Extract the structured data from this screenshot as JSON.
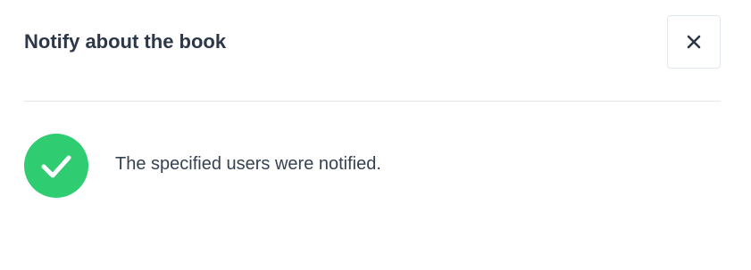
{
  "dialog": {
    "title": "Notify about the book",
    "close_icon": "close-icon",
    "message": "The specified users were notified.",
    "status_icon": "check-circle-icon"
  },
  "colors": {
    "success": "#2fcc71",
    "title_text": "#2d3748",
    "body_text": "#374151",
    "divider": "#e5e7eb"
  }
}
